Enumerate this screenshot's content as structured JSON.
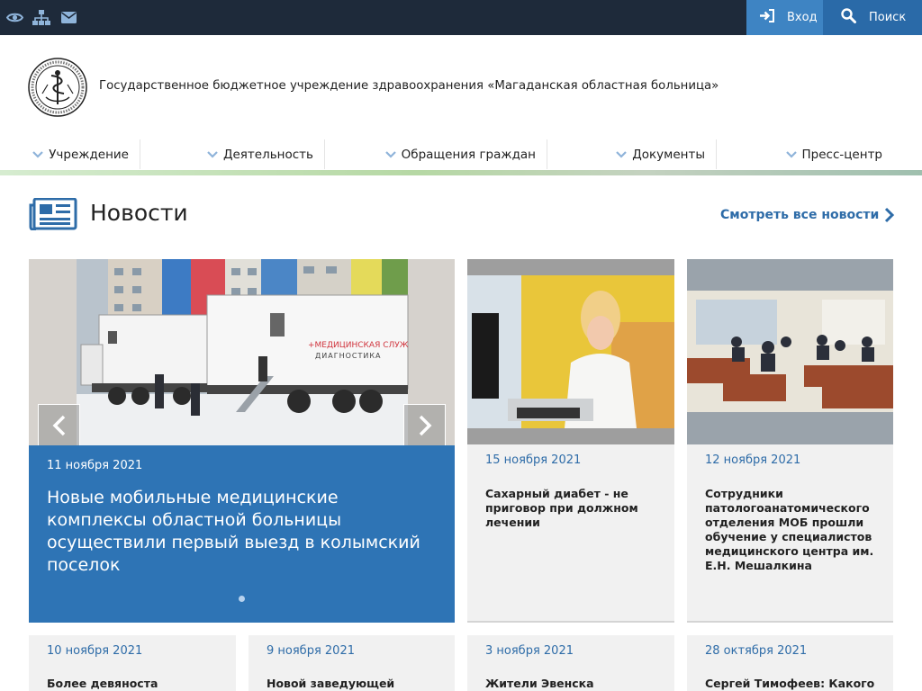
{
  "topbar": {
    "icons": [
      "eye-icon",
      "sitemap-icon",
      "envelope-icon"
    ],
    "login_label": "Вход",
    "search_label": "Поиск"
  },
  "header": {
    "org_name": "Государственное бюджетное учреждение здравоохранения «Магаданская областная больница»"
  },
  "menu": {
    "items": [
      {
        "label": "Учреждение"
      },
      {
        "label": "Деятельность"
      },
      {
        "label": "Обращения граждан"
      },
      {
        "label": "Документы"
      },
      {
        "label": "Пресс-центр"
      }
    ]
  },
  "news": {
    "title": "Новости",
    "all_link": "Смотреть все новости",
    "slide": {
      "date": "11 ноября 2021",
      "title": "Новые мобильные медицинские комплексы областной больницы осуществили первый выезд в колымский поселок",
      "truck_text_1": "+МЕДИЦИНСКАЯ СЛУЖ",
      "truck_text_2": "ДИАГНОСТИКА"
    },
    "cards": [
      {
        "date": "15 ноября 2021",
        "title": "Сахарный диабет - не приговор при должном лечении"
      },
      {
        "date": "12 ноября 2021",
        "title": "Сотрудники патологоанатомического отделения МОБ прошли обучение у специалистов медицинского центра им. Е.Н. Мешалкина"
      },
      {
        "date": "10 ноября 2021",
        "title": "Более девяноста"
      },
      {
        "date": "9 ноября 2021",
        "title": "Новой заведующей"
      },
      {
        "date": "3 ноября 2021",
        "title": "Жители Эвенска"
      },
      {
        "date": "28 октября 2021",
        "title": "Сергей Тимофеев: Какого"
      }
    ]
  },
  "colors": {
    "topbar": "#1e2a3a",
    "login_bg": "#3e84c3",
    "search_bg": "#2a6aa8",
    "slider_bg": "#2e74b5",
    "link": "#2e6ca8",
    "card_bg": "#f1f1f1"
  }
}
